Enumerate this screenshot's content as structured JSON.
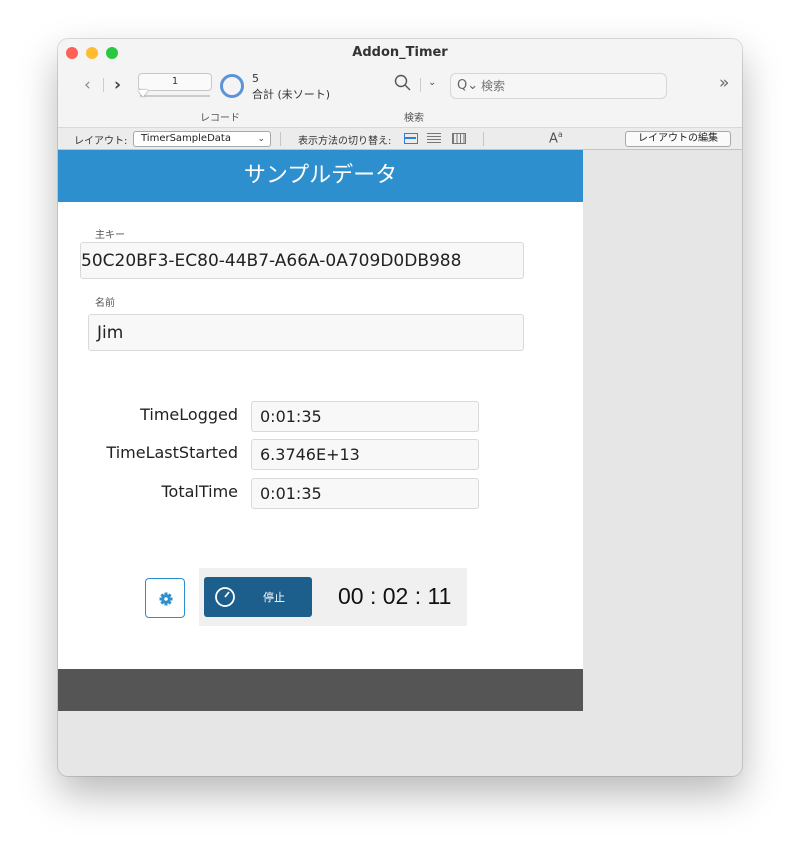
{
  "window": {
    "title": "Addon_Timer"
  },
  "toolbar": {
    "record_current": "1",
    "record_total": "5",
    "record_sort_status": "合計 (未ソート)",
    "record_caption": "レコード",
    "find_caption": "検索",
    "search_placeholder": "検索",
    "overflow_glyph": "»"
  },
  "layout_bar": {
    "layout_label": "レイアウト:",
    "layout_name": "TimerSampleData",
    "view_as_label": "表示方法の切り替え:",
    "edit_layout_label": "レイアウトの編集",
    "text_format_glyph": "A"
  },
  "form": {
    "header_title": "サンプルデータ",
    "primary_key_label": "主キー",
    "primary_key_value": "50C20BF3-EC80-44B7-A66A-0A709D0DB988",
    "name_label": "名前",
    "name_value": "Jim",
    "rows": [
      {
        "label": "TimeLogged",
        "value": "0:01:35"
      },
      {
        "label": "TimeLastStarted",
        "value": "6.3746E+13"
      },
      {
        "label": "TotalTime",
        "value": "0:01:35"
      }
    ]
  },
  "timer": {
    "stop_label": "停止",
    "display": "00 : 02 : 11"
  },
  "colors": {
    "header_band": "#2d8fcd",
    "stop_button": "#1c5e8c",
    "footer_band": "#555555",
    "record_ring": "#5b93d8"
  }
}
